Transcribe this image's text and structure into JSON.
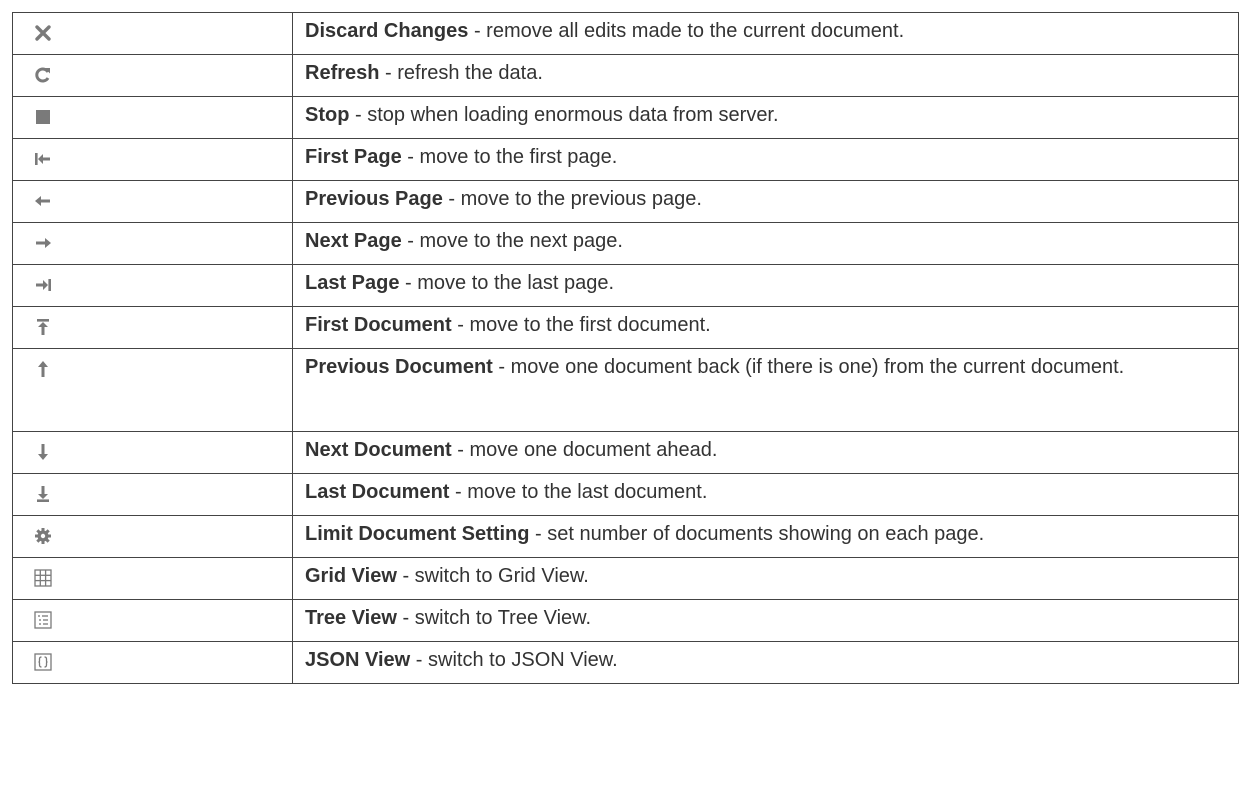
{
  "rows": [
    {
      "icon": "close-icon",
      "name": "Discard Changes",
      "desc": " - remove all edits made to the current document."
    },
    {
      "icon": "refresh-icon",
      "name": "Refresh",
      "desc": " - refresh the data."
    },
    {
      "icon": "stop-icon",
      "name": "Stop",
      "desc": " - stop when loading enormous data from server."
    },
    {
      "icon": "first-page-icon",
      "name": "First Page",
      "desc": " - move to the first page."
    },
    {
      "icon": "previous-page-icon",
      "name": "Previous Page",
      "desc": " - move to the previous page."
    },
    {
      "icon": "next-page-icon",
      "name": "Next Page",
      "desc": " - move to the next page."
    },
    {
      "icon": "last-page-icon",
      "name": "Last Page",
      "desc": " - move to the last page."
    },
    {
      "icon": "first-document-icon",
      "name": "First Document",
      "desc": " - move to the first document."
    },
    {
      "icon": "previous-document-icon",
      "name": "Previous Document",
      "desc": " - move one document back (if there is one) from the current document."
    },
    {
      "icon": "next-document-icon",
      "name": "Next Document",
      "desc": " - move one document ahead."
    },
    {
      "icon": "last-document-icon",
      "name": "Last Document",
      "desc": " - move to the last document."
    },
    {
      "icon": "gear-icon",
      "name": "Limit Document Setting",
      "desc": " - set number of documents showing on each page."
    },
    {
      "icon": "grid-view-icon",
      "name": "Grid View",
      "desc": " - switch to Grid View."
    },
    {
      "icon": "tree-view-icon",
      "name": "Tree View",
      "desc": " - switch to Tree View."
    },
    {
      "icon": "json-view-icon",
      "name": "JSON View",
      "desc": " - switch to JSON View."
    }
  ],
  "colors": {
    "icon_gray": "#7a7a7a",
    "border": "#444444",
    "text": "#333333"
  }
}
